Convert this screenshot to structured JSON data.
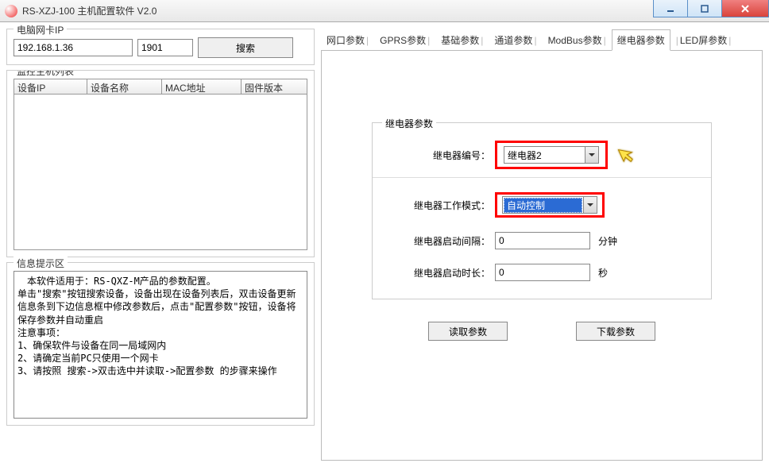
{
  "window": {
    "title": "RS-XZJ-100 主机配置软件 V2.0"
  },
  "left": {
    "netcard": {
      "legend": "电脑网卡IP",
      "ip": "192.168.1.36",
      "port": "1901",
      "search_btn": "搜索"
    },
    "hostlist": {
      "legend": "监控主机列表",
      "cols": [
        "设备IP",
        "设备名称",
        "MAC地址",
        "固件版本"
      ]
    },
    "info": {
      "legend": "信息提示区",
      "text": "　本软件适用于：RS-QXZ-M产品的参数配置。\n单击\"搜索\"按钮搜索设备，设备出现在设备列表后，双击设备更新信息条到下边信息框中修改参数后，点击\"配置参数\"按钮，设备将保存参数并自动重启\n注意事项：\n1、确保软件与设备在同一局域网内\n2、请确定当前PC只使用一个网卡\n3、请按照 搜索->双击选中并读取->配置参数 的步骤来操作"
    }
  },
  "tabs": [
    "网口参数",
    "GPRS参数",
    "基础参数",
    "通道参数",
    "ModBus参数",
    "继电器参数",
    "LED屏参数"
  ],
  "active_tab": "继电器参数",
  "relay": {
    "group_legend": "继电器参数",
    "row1_label": "继电器编号：",
    "row1_value": "继电器2",
    "row2_label": "继电器工作模式：",
    "row2_value": "自动控制",
    "row3_label": "继电器启动间隔：",
    "row3_value": "0",
    "row3_unit": "分钟",
    "row4_label": "继电器启动时长：",
    "row4_value": "0",
    "row4_unit": "秒"
  },
  "buttons": {
    "read": "读取参数",
    "download": "下载参数"
  }
}
